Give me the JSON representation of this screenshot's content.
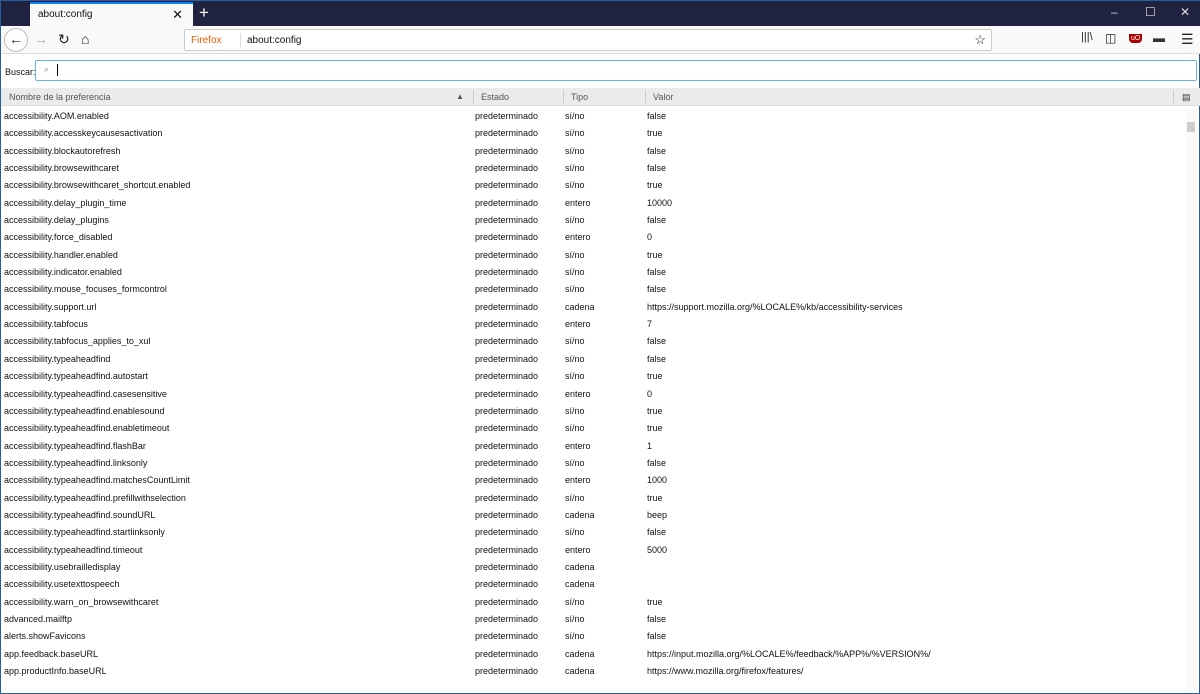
{
  "tab": {
    "title": "about:config",
    "close": "✕"
  },
  "new_tab": "+",
  "window": {
    "minimize": "–",
    "maximize": "☐",
    "close": "✕"
  },
  "nav": {
    "back": "←",
    "forward": "→",
    "reload": "↻",
    "home": "⌂"
  },
  "url": {
    "identity": "Firefox",
    "value": "about:config",
    "star": "☆"
  },
  "toolbar": {
    "library": "|||\\",
    "sidebar": "◫",
    "ublock": "uO",
    "ext": "▬",
    "menu": "☰"
  },
  "search": {
    "label": "Buscar:",
    "value": ""
  },
  "columns": [
    "Nombre de la preferencia",
    "Estado",
    "Tipo",
    "Valor"
  ],
  "sort_indicator": "▲",
  "rows": [
    [
      "accessibility.AOM.enabled",
      "predeterminado",
      "sí/no",
      "false"
    ],
    [
      "accessibility.accesskeycausesactivation",
      "predeterminado",
      "sí/no",
      "true"
    ],
    [
      "accessibility.blockautorefresh",
      "predeterminado",
      "sí/no",
      "false"
    ],
    [
      "accessibility.browsewithcaret",
      "predeterminado",
      "sí/no",
      "false"
    ],
    [
      "accessibility.browsewithcaret_shortcut.enabled",
      "predeterminado",
      "sí/no",
      "true"
    ],
    [
      "accessibility.delay_plugin_time",
      "predeterminado",
      "entero",
      "10000"
    ],
    [
      "accessibility.delay_plugins",
      "predeterminado",
      "sí/no",
      "false"
    ],
    [
      "accessibility.force_disabled",
      "predeterminado",
      "entero",
      "0"
    ],
    [
      "accessibility.handler.enabled",
      "predeterminado",
      "sí/no",
      "true"
    ],
    [
      "accessibility.indicator.enabled",
      "predeterminado",
      "sí/no",
      "false"
    ],
    [
      "accessibility.mouse_focuses_formcontrol",
      "predeterminado",
      "sí/no",
      "false"
    ],
    [
      "accessibility.support.url",
      "predeterminado",
      "cadena",
      "https://support.mozilla.org/%LOCALE%/kb/accessibility-services"
    ],
    [
      "accessibility.tabfocus",
      "predeterminado",
      "entero",
      "7"
    ],
    [
      "accessibility.tabfocus_applies_to_xul",
      "predeterminado",
      "sí/no",
      "false"
    ],
    [
      "accessibility.typeaheadfind",
      "predeterminado",
      "sí/no",
      "false"
    ],
    [
      "accessibility.typeaheadfind.autostart",
      "predeterminado",
      "sí/no",
      "true"
    ],
    [
      "accessibility.typeaheadfind.casesensitive",
      "predeterminado",
      "entero",
      "0"
    ],
    [
      "accessibility.typeaheadfind.enablesound",
      "predeterminado",
      "sí/no",
      "true"
    ],
    [
      "accessibility.typeaheadfind.enabletimeout",
      "predeterminado",
      "sí/no",
      "true"
    ],
    [
      "accessibility.typeaheadfind.flashBar",
      "predeterminado",
      "entero",
      "1"
    ],
    [
      "accessibility.typeaheadfind.linksonly",
      "predeterminado",
      "sí/no",
      "false"
    ],
    [
      "accessibility.typeaheadfind.matchesCountLimit",
      "predeterminado",
      "entero",
      "1000"
    ],
    [
      "accessibility.typeaheadfind.prefillwithselection",
      "predeterminado",
      "sí/no",
      "true"
    ],
    [
      "accessibility.typeaheadfind.soundURL",
      "predeterminado",
      "cadena",
      "beep"
    ],
    [
      "accessibility.typeaheadfind.startlinksonly",
      "predeterminado",
      "sí/no",
      "false"
    ],
    [
      "accessibility.typeaheadfind.timeout",
      "predeterminado",
      "entero",
      "5000"
    ],
    [
      "accessibility.usebrailledisplay",
      "predeterminado",
      "cadena",
      ""
    ],
    [
      "accessibility.usetexttospeech",
      "predeterminado",
      "cadena",
      ""
    ],
    [
      "accessibility.warn_on_browsewithcaret",
      "predeterminado",
      "sí/no",
      "true"
    ],
    [
      "advanced.mailftp",
      "predeterminado",
      "sí/no",
      "false"
    ],
    [
      "alerts.showFavicons",
      "predeterminado",
      "sí/no",
      "false"
    ],
    [
      "app.feedback.baseURL",
      "predeterminado",
      "cadena",
      "https://input.mozilla.org/%LOCALE%/feedback/%APP%/%VERSION%/"
    ],
    [
      "app.productInfo.baseURL",
      "predeterminado",
      "cadena",
      "https://www.mozilla.org/firefox/features/"
    ]
  ]
}
